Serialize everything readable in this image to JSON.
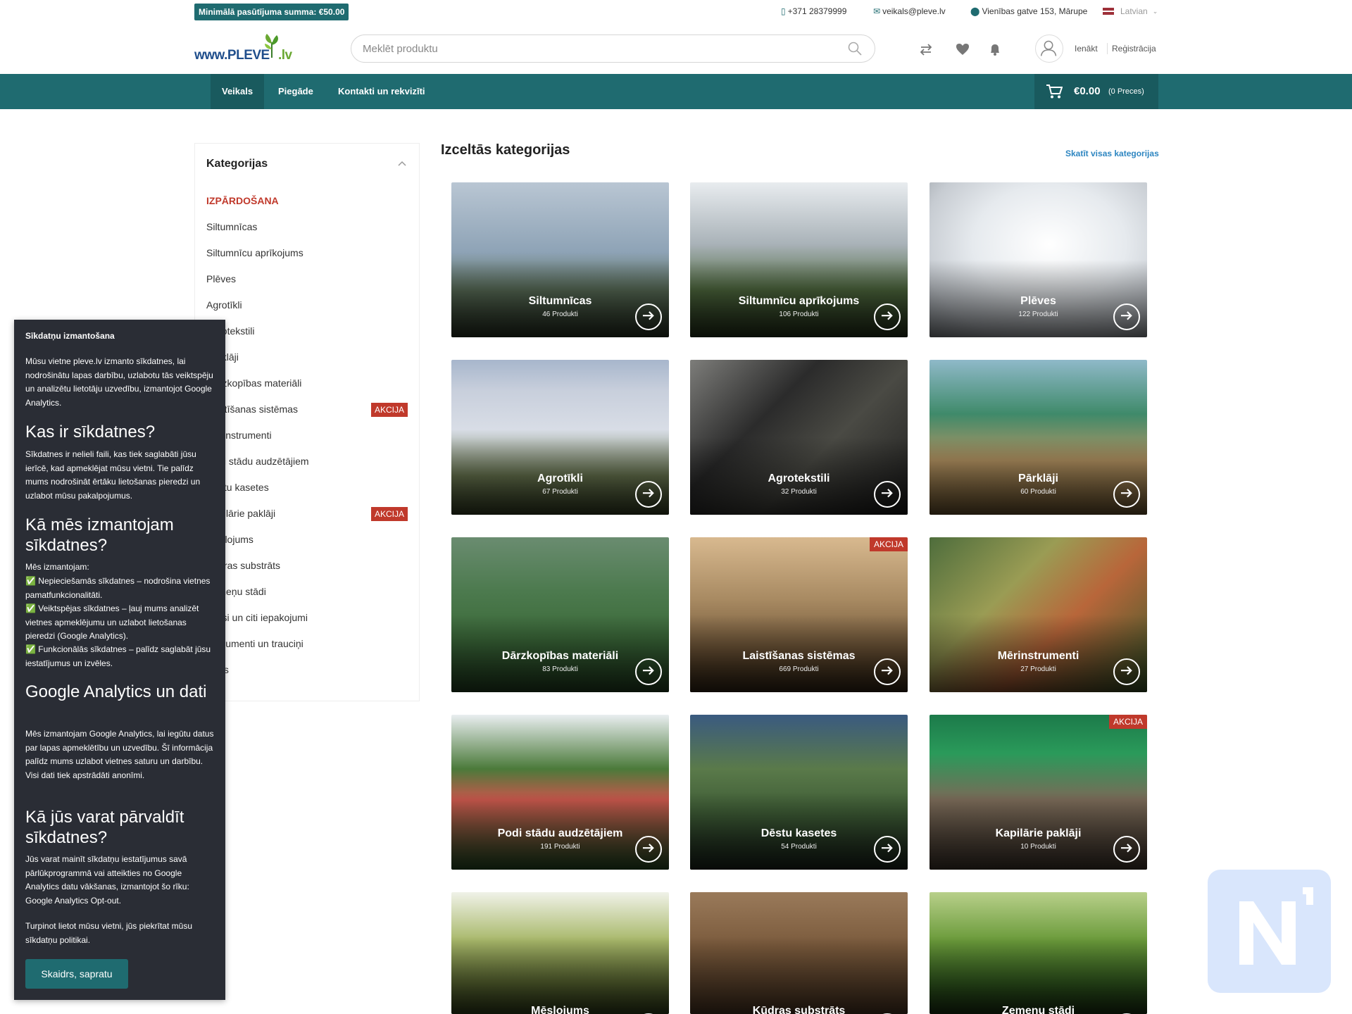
{
  "topbar": {
    "min_order": "Minimālā pasūtījuma summa: €50.00",
    "phone": "+371 28379999",
    "email": "veikals@pleve.lv",
    "address": "Vienības gatve 153, Mārupe",
    "language": "Latvian"
  },
  "header": {
    "logo_text": "www.PLEVE",
    "logo_suffix": ".lv",
    "search_placeholder": "Meklēt produktu",
    "login": "Ienākt",
    "register": "Reģistrācija"
  },
  "nav": {
    "items": [
      "Veikals",
      "Piegāde",
      "Kontakti un rekvizīti"
    ],
    "cart_amount": "€0.00",
    "cart_count": "(0 Preces)"
  },
  "sidebar": {
    "title": "Kategorijas",
    "sale": "IZPĀRDOŠANA",
    "items": [
      {
        "label": "Siltumnīcas",
        "badge": ""
      },
      {
        "label": "Siltumnīcu aprīkojums",
        "badge": ""
      },
      {
        "label": "Plēves",
        "badge": ""
      },
      {
        "label": "Agrotīkli",
        "badge": ""
      },
      {
        "label": "Agrotekstili",
        "badge": ""
      },
      {
        "label": "Pārklāji",
        "badge": ""
      },
      {
        "label": "Dārzkopības materiāli",
        "badge": ""
      },
      {
        "label": "Laistīšanas sistēmas",
        "badge": "AKCIJA"
      },
      {
        "label": "Mērinstrumenti",
        "badge": ""
      },
      {
        "label": "Podi stādu audzētājiem",
        "badge": ""
      },
      {
        "label": "Dēstu kasetes",
        "badge": ""
      },
      {
        "label": "Kapilārie paklāji",
        "badge": "AKCIJA"
      },
      {
        "label": "Mēslojums",
        "badge": ""
      },
      {
        "label": "Kūdras substrāts",
        "badge": ""
      },
      {
        "label": "Zemeņu stādi",
        "badge": ""
      },
      {
        "label": "Maisi un citi iepakojumi",
        "badge": ""
      },
      {
        "label": "Instrumenti un trauciņi",
        "badge": ""
      },
      {
        "label": "Citas",
        "badge": ""
      }
    ]
  },
  "main": {
    "title": "Izceltās kategorijas",
    "view_all": "Skatīt visas kategorijas",
    "tiles": [
      {
        "name": "Siltumnīcas",
        "count": "46 Produkti",
        "badge": ""
      },
      {
        "name": "Siltumnīcu aprīkojums",
        "count": "106 Produkti",
        "badge": ""
      },
      {
        "name": "Plēves",
        "count": "122 Produkti",
        "badge": ""
      },
      {
        "name": "Agrotīkli",
        "count": "67 Produkti",
        "badge": ""
      },
      {
        "name": "Agrotekstili",
        "count": "32 Produkti",
        "badge": ""
      },
      {
        "name": "Pārklāji",
        "count": "60 Produkti",
        "badge": ""
      },
      {
        "name": "Dārzkopības materiāli",
        "count": "83 Produkti",
        "badge": ""
      },
      {
        "name": "Laistīšanas sistēmas",
        "count": "669 Produkti",
        "badge": "AKCIJA"
      },
      {
        "name": "Mērinstrumenti",
        "count": "27 Produkti",
        "badge": ""
      },
      {
        "name": "Podi stādu audzētājiem",
        "count": "191 Produkti",
        "badge": ""
      },
      {
        "name": "Dēstu kasetes",
        "count": "54 Produkti",
        "badge": ""
      },
      {
        "name": "Kapilārie paklāji",
        "count": "10 Produkti",
        "badge": "AKCIJA"
      },
      {
        "name": "Mēslojums",
        "count": "",
        "badge": ""
      },
      {
        "name": "Kūdras substrāts",
        "count": "",
        "badge": ""
      },
      {
        "name": "Zemeņu stādi",
        "count": "",
        "badge": ""
      }
    ]
  },
  "cookie": {
    "title": "Sīkdatņu izmantošana",
    "intro": "Mūsu vietne pleve.lv izmanto sīkdatnes, lai nodrošinātu lapas darbību, uzlabotu tās veiktspēju un analizētu lietotāju uzvedību, izmantojot Google Analytics.",
    "h1": "Kas ir sīkdatnes?",
    "p1": "Sīkdatnes ir nelieli faili, kas tiek saglabāti jūsu ierīcē, kad apmeklējat mūsu vietni. Tie palīdz mums nodrošināt ērtāku lietošanas pieredzi un uzlabot mūsu pakalpojumus.",
    "h2": "Kā mēs izmantojam sīkdatnes?",
    "p2": "Mēs izmantojam:",
    "b1": "✅ Nepieciešamās sīkdatnes – nodrošina vietnes pamatfunkcionalitāti.",
    "b2": "✅ Veiktspējas sīkdatnes – ļauj mums analizēt vietnes apmeklējumu un uzlabot lietošanas pieredzi (Google Analytics).",
    "b3": "✅ Funkcionālās sīkdatnes – palīdz saglabāt jūsu iestatījumus un izvēles.",
    "h3": "Google Analytics un dati",
    "p3": "Mēs izmantojam Google Analytics, lai iegūtu datus par lapas apmeklētību un uzvedību. Šī informācija palīdz mums uzlabot vietnes saturu un darbību. Visi dati tiek apstrādāti anonīmi.",
    "h4": "Kā jūs varat pārvaldīt sīkdatnes?",
    "p4": "Jūs varat mainīt sīkdatņu iestatījumus savā pārlūkprogrammā vai atteikties no Google Analytics datu vākšanas, izmantojot šo rīku: Google Analytics Opt-out.",
    "p5": "Turpinot lietot mūsu vietni, jūs piekrītat mūsu sīkdatņu politikai.",
    "button": "Skaidrs, sapratu"
  },
  "colors": {
    "brand": "#1f6b70",
    "sale": "#c0392b",
    "link": "#2e86c1",
    "cookie_bg": "#2a2d35"
  }
}
